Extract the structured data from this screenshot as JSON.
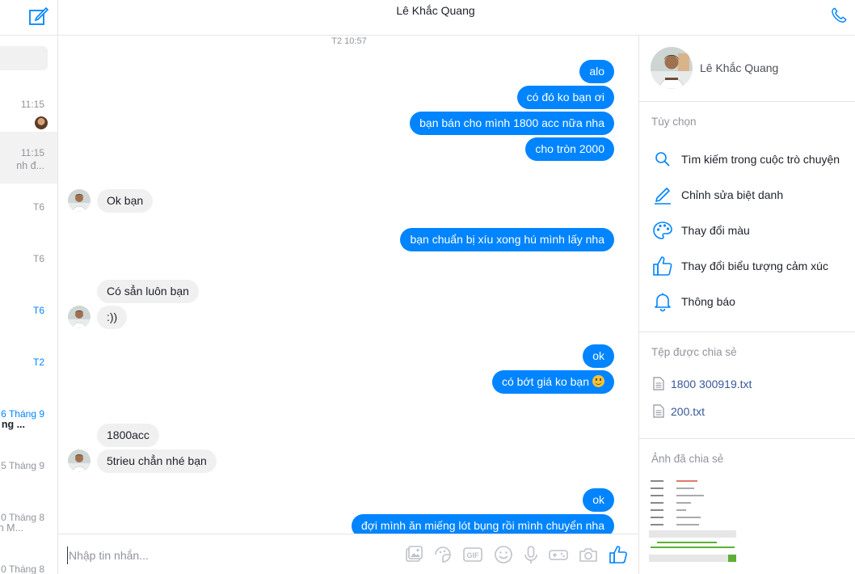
{
  "conversation": {
    "title": "Lê Khắc Quang",
    "timestamp": "T2 10:57"
  },
  "left_list": [
    {
      "time": "11:15",
      "preview": "",
      "time_blue": false,
      "has_avatar": true
    },
    {
      "time": "11:15",
      "preview": "nh đ...",
      "time_blue": false,
      "selected": true
    },
    {
      "time": "T6",
      "preview": "",
      "time_blue": false
    },
    {
      "time": "T6",
      "preview": "",
      "time_blue": false
    },
    {
      "time": "T6",
      "preview": "",
      "time_blue": true
    },
    {
      "time": "T2",
      "preview": "",
      "time_blue": true
    },
    {
      "time": "6 Tháng 9",
      "preview": "ng ...",
      "time_blue": true,
      "bold": true
    },
    {
      "time": "5 Tháng 9",
      "preview": "",
      "time_blue": false
    },
    {
      "time": "0 Tháng 8",
      "preview": "n M...",
      "time_blue": false
    },
    {
      "time": "0 Tháng 8",
      "preview": "",
      "time_blue": false
    }
  ],
  "messages": [
    {
      "from": "me",
      "text": "alo"
    },
    {
      "from": "me",
      "text": "có đó ko bạn ơi"
    },
    {
      "from": "me",
      "text": "bạn bán cho mình 1800 acc nữa nha"
    },
    {
      "from": "me",
      "text": "cho tròn 2000"
    },
    {
      "from": "them",
      "text": "Ok bạn"
    },
    {
      "from": "me",
      "text": "bạn chuẩn bị xíu xong hú mình lấy nha"
    },
    {
      "from": "them",
      "text": "Có sẳn luôn bạn"
    },
    {
      "from": "them",
      "text": ":))"
    },
    {
      "from": "me",
      "text": "ok"
    },
    {
      "from": "me",
      "text": "có bớt giá ko bạn"
    },
    {
      "from": "them",
      "text": "1800acc"
    },
    {
      "from": "them",
      "text": "5trieu chẳn nhé bạn"
    },
    {
      "from": "me",
      "text": "ok"
    },
    {
      "from": "me",
      "text": "đợi mình ăn miếng lót bụng rồi mình chuyển nha"
    }
  ],
  "composer": {
    "placeholder": "Nhập tin nhắn..."
  },
  "info_panel": {
    "name": "Lê Khắc Quang",
    "options_title": "Tùy chọn",
    "options": [
      {
        "icon": "search-icon",
        "label": "Tìm kiếm trong cuộc trò chuyện"
      },
      {
        "icon": "pencil-icon",
        "label": "Chỉnh sửa biệt danh"
      },
      {
        "icon": "palette-icon",
        "label": "Thay đổi màu"
      },
      {
        "icon": "thumbs-up-icon",
        "label": "Thay đổi biểu tượng cảm xúc"
      },
      {
        "icon": "bell-icon",
        "label": "Thông báo"
      }
    ],
    "files_title": "Tệp được chia sẻ",
    "files": [
      "1800 300919.txt",
      "200.txt"
    ],
    "photos_title": "Ảnh đã chia sẻ"
  },
  "colors": {
    "accent": "#0084ff",
    "incoming_bubble": "#f1f0f0",
    "link": "#365899"
  }
}
